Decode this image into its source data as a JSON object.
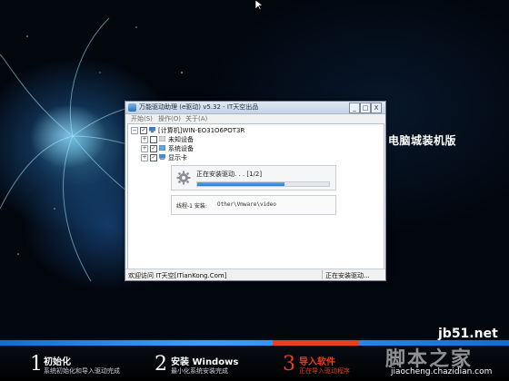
{
  "desktop": {
    "brand_text": "电脑城装机版"
  },
  "window": {
    "title": "万能驱动助理 (e驱动) v5.32 - IT天空出品",
    "controls": {
      "minimize": "_",
      "maximize": "□",
      "close": "X"
    },
    "menu": [
      "开始(S)",
      "操作(O)",
      "关于(A)"
    ],
    "tree": {
      "root": {
        "label": "[计算机]WIN-EO31O6POT3R",
        "checked": true
      },
      "children": [
        {
          "label": "未知设备",
          "checked": false
        },
        {
          "label": "系统设备",
          "checked": true
        },
        {
          "label": "显示卡",
          "checked": true
        }
      ]
    },
    "progress": {
      "text": "正在安装驱动. . .  [1/2]",
      "fraction": 0.66
    },
    "info": {
      "label": "线程-1 安装:",
      "path": "Other\\Vmware\\video"
    },
    "status": {
      "left": "欢迎访问 IT天空[ITianKong.Com]",
      "right": "正在安装驱动..."
    }
  },
  "steps": [
    {
      "num": "1",
      "title": "初始化",
      "subtitle": "系统初始化和导入驱动完成",
      "active": false
    },
    {
      "num": "2",
      "title": "安装 Windows",
      "subtitle": "最小化系统安装完成",
      "active": false
    },
    {
      "num": "3",
      "title": "导入软件",
      "subtitle": "正在导入驱动程序",
      "active": true
    }
  ],
  "watermark": {
    "site": "jb51.net",
    "brand": "脚本之家",
    "url": "jiaocheng.chazidian.com"
  },
  "colors": {
    "progress_fill": "#2b7fd2",
    "active_step": "#ef3b1e",
    "step_bar": "#3aa0ff"
  }
}
